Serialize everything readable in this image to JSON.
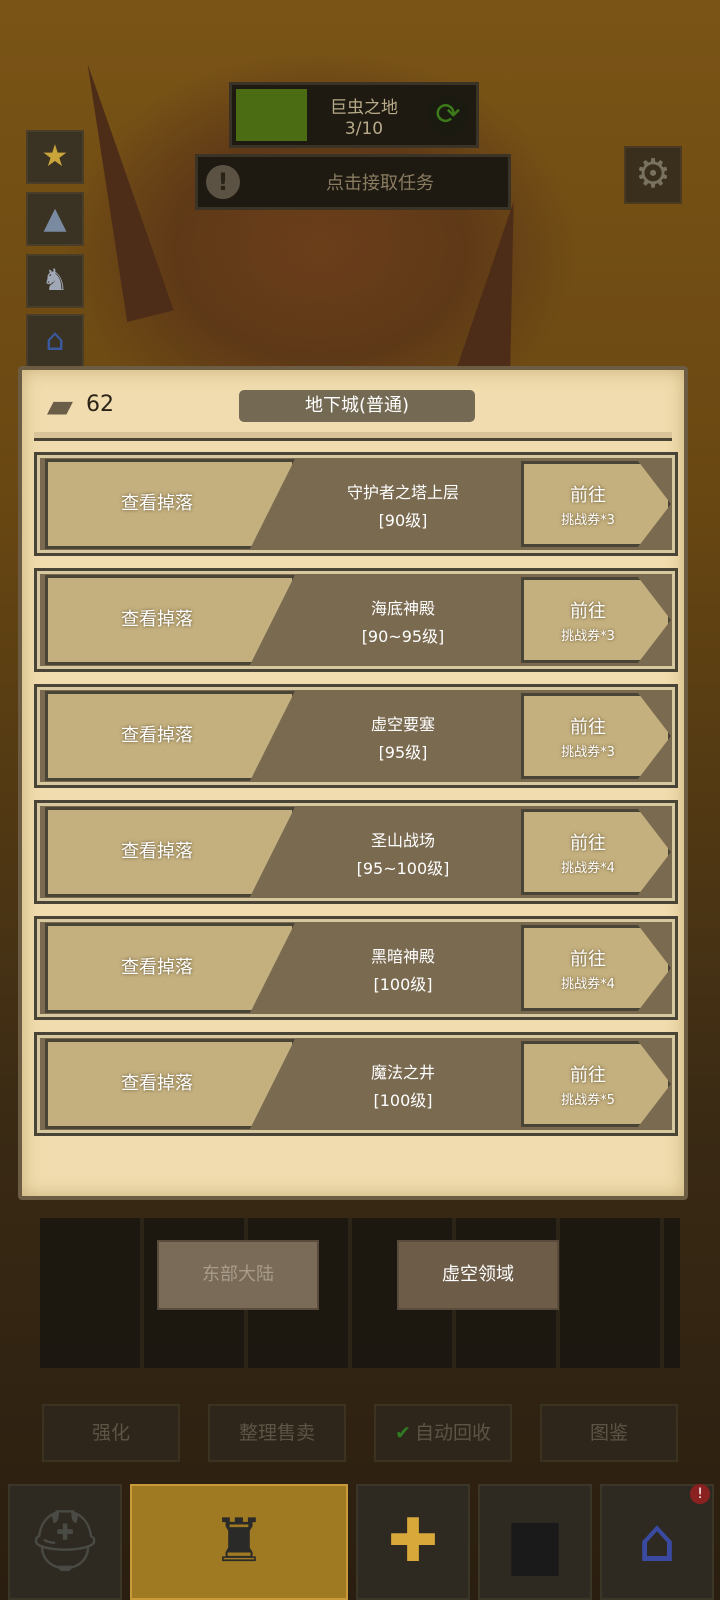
{
  "quest": {
    "name": "巨虫之地",
    "progress": "3/10",
    "progress_fraction": 0.3
  },
  "task_prompt": "点击接取任务",
  "panel": {
    "ticket_count": "62",
    "title": "地下城(普通)"
  },
  "dungeons": [
    {
      "drop_label": "查看掉落",
      "name": "守护者之塔上层",
      "level": "[90级]",
      "go_label": "前往",
      "cost": "挑战券*3"
    },
    {
      "drop_label": "查看掉落",
      "name": "海底神殿",
      "level": "[90~95级]",
      "go_label": "前往",
      "cost": "挑战券*3"
    },
    {
      "drop_label": "查看掉落",
      "name": "虚空要塞",
      "level": "[95级]",
      "go_label": "前往",
      "cost": "挑战券*3"
    },
    {
      "drop_label": "查看掉落",
      "name": "圣山战场",
      "level": "[95~100级]",
      "go_label": "前往",
      "cost": "挑战券*4"
    },
    {
      "drop_label": "查看掉落",
      "name": "黑暗神殿",
      "level": "[100级]",
      "go_label": "前往",
      "cost": "挑战券*4"
    },
    {
      "drop_label": "查看掉落",
      "name": "魔法之井",
      "level": "[100级]",
      "go_label": "前往",
      "cost": "挑战券*5"
    }
  ],
  "regions": {
    "east": "东部大陆",
    "void": "虚空领域"
  },
  "actions": {
    "enhance": "强化",
    "sell": "整理售卖",
    "auto_recycle": "自动回收",
    "catalog": "图鉴"
  },
  "notification_badge": "!"
}
